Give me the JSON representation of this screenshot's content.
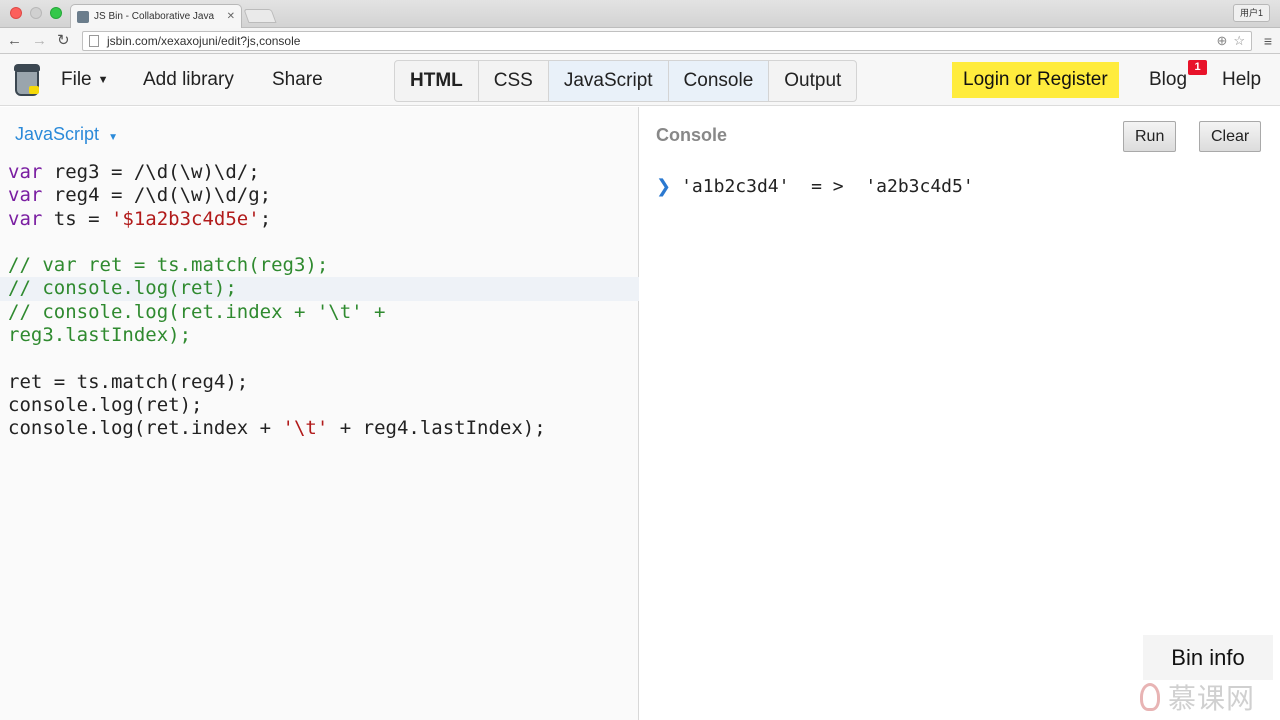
{
  "browser": {
    "tab_title": "JS Bin - Collaborative Java",
    "tab_close": "✕",
    "user_badge": "用户1",
    "url": "jsbin.com/xexaxojuni/edit?js,console",
    "icons": [
      "back-arrow-icon",
      "forward-arrow-icon",
      "reload-icon",
      "zoom-icon",
      "star-icon",
      "menu-icon"
    ]
  },
  "toolbar": {
    "file_label": "File",
    "add_library_label": "Add library",
    "share_label": "Share",
    "panels": [
      {
        "label": "HTML",
        "bold": true,
        "active": false
      },
      {
        "label": "CSS",
        "bold": false,
        "active": false
      },
      {
        "label": "JavaScript",
        "bold": false,
        "active": true
      },
      {
        "label": "Console",
        "bold": false,
        "active": true
      },
      {
        "label": "Output",
        "bold": false,
        "active": false
      }
    ],
    "login_label": "Login or Register",
    "blog_label": "Blog",
    "blog_badge": "1",
    "help_label": "Help",
    "accent_color": "#ffec3d"
  },
  "editor": {
    "language": "JavaScript",
    "lines": [
      [
        {
          "t": "var",
          "c": "kw"
        },
        {
          "t": " reg3 = /\\d(\\w)\\d/;",
          "c": ""
        }
      ],
      [
        {
          "t": "var",
          "c": "kw"
        },
        {
          "t": " reg4 = /\\d(\\w)\\d/g;",
          "c": ""
        }
      ],
      [
        {
          "t": "var",
          "c": "kw"
        },
        {
          "t": " ts = ",
          "c": ""
        },
        {
          "t": "'$1a2b3c4d5e'",
          "c": "str"
        },
        {
          "t": ";",
          "c": ""
        }
      ],
      [],
      [
        {
          "t": "// var ret = ts.match(reg3);",
          "c": "cm"
        }
      ],
      [
        {
          "t": "// console.log(ret);",
          "c": "cm"
        }
      ],
      [
        {
          "t": "// console.log(ret.index + '\\t' +",
          "c": "cm"
        }
      ],
      [
        {
          "t": "reg3.lastIndex);",
          "c": "cm"
        }
      ],
      [],
      [
        {
          "t": "ret = ts.match(reg4);",
          "c": ""
        }
      ],
      [
        {
          "t": "console.log(ret);",
          "c": ""
        }
      ],
      [
        {
          "t": "console.log(ret.index + ",
          "c": ""
        },
        {
          "t": "'\\t'",
          "c": "str"
        },
        {
          "t": " + reg4.lastIndex);",
          "c": ""
        }
      ]
    ],
    "active_line": 5
  },
  "console": {
    "title": "Console",
    "run_label": "Run",
    "clear_label": "Clear",
    "prompt": "❯",
    "output": "'a1b2c3d4'  = >  'a2b3c4d5'"
  },
  "bin_info_label": "Bin info",
  "watermark": "慕课网"
}
